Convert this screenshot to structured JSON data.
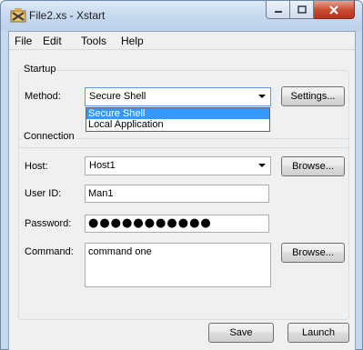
{
  "window": {
    "title": "File2.xs - Xstart",
    "icon": "xstart-app-icon"
  },
  "menu": {
    "items": [
      "File",
      "Edit",
      "Tools",
      "Help"
    ]
  },
  "startup": {
    "group_label": "Startup",
    "method_label": "Method:",
    "method_value": "Secure Shell",
    "method_options": [
      "Secure Shell",
      "Local Application"
    ],
    "settings_button": "Settings..."
  },
  "connection": {
    "group_label": "Connection",
    "host_label": "Host:",
    "host_value": "Host1",
    "host_browse_button": "Browse...",
    "userid_label": "User ID:",
    "userid_value": "Man1",
    "password_label": "Password:",
    "password_value": "●●●●●●●●●●●",
    "command_label": "Command:",
    "command_value": "command one",
    "command_browse_button": "Browse..."
  },
  "footer": {
    "save_button": "Save",
    "launch_button": "Launch"
  },
  "colors": {
    "selection": "#3399ff",
    "close_button": "#c8492f",
    "titlebar": "#c4d7ee"
  }
}
